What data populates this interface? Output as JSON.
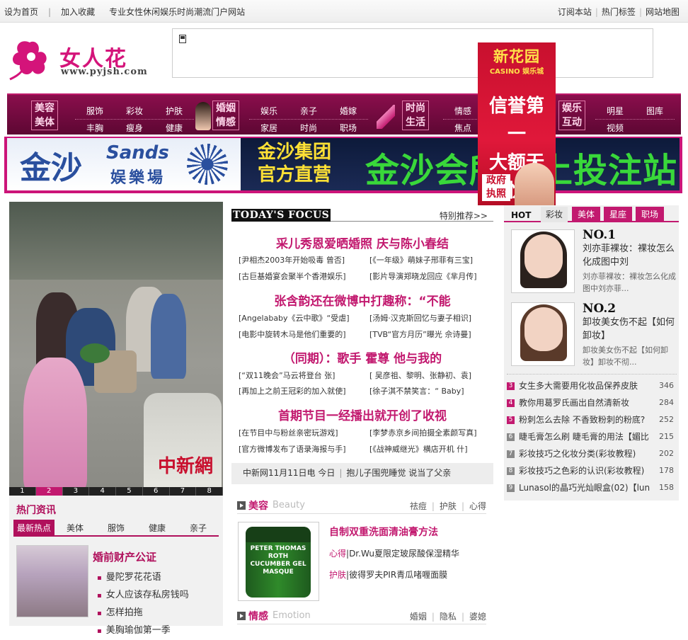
{
  "topbar": {
    "left": [
      "设为首页",
      "加入收藏",
      "专业女性休闲娱乐时尚潮流门户网站"
    ],
    "sep": "|",
    "right": [
      "订阅本站",
      "热门标签",
      "网站地图"
    ]
  },
  "logo": {
    "name": "女人花",
    "url": "www.pyjsh.com"
  },
  "nav": [
    {
      "head": [
        "美容",
        "美体"
      ],
      "items": [
        [
          "服饰",
          "彩妆",
          "护肤"
        ],
        [
          "丰胸",
          "瘦身",
          "健康"
        ]
      ]
    },
    {
      "head": [
        "婚姻",
        "情感"
      ],
      "items": [
        [
          "娱乐",
          "亲子",
          "婚嫁"
        ],
        [
          "家居",
          "时尚",
          "职场"
        ]
      ]
    },
    {
      "head": [
        "时尚",
        "生活"
      ],
      "items": [
        [
          "情感"
        ],
        [
          "焦点"
        ]
      ]
    },
    {
      "head": [
        "娱乐",
        "互动"
      ],
      "items": [
        [
          "明星",
          "图库"
        ],
        [
          "视频"
        ]
      ]
    }
  ],
  "tall_ad": {
    "line1": "新花园",
    "line2": "CASINO 娱乐城",
    "line3": "信誉第一",
    "line4": "大额无忧",
    "badge": "政府执照"
  },
  "banner": {
    "left_cn": "金沙",
    "left_en": "Sands",
    "left_sub": "娱樂場",
    "right_a": "金沙集团",
    "right_b": "官方直营",
    "right_c": "金沙会所会上投注站"
  },
  "slideshow": {
    "dots": [
      "1",
      "2",
      "3",
      "4",
      "5",
      "6",
      "7",
      "8"
    ],
    "active": 1,
    "stamp": "中新網"
  },
  "hot_news": {
    "heading": "热门资讯",
    "tabs": [
      "最新热点",
      "美体",
      "服饰",
      "健康",
      "亲子"
    ],
    "active_tab": 0,
    "title": "婚前财产公证",
    "items": [
      "曼陀罗花花语",
      "女人应该存私房钱吗",
      "怎样拍拖",
      "美胸瑜伽第一季"
    ]
  },
  "focus": {
    "heading": "TODAY'S FOCUS",
    "more": "特别推荐>>",
    "blocks": [
      {
        "title": "采儿秀恩爱晒婚照 庆与陈小春结",
        "rows": [
          [
            "[尹相杰2003年开始吸毒 曾否]",
            "[《一年级》萌妹子邢菲有三宝]"
          ],
          [
            "[古巨基婚宴会聚半个香港娱乐]",
            "[影片导演郑晓龙回应《芈月传]"
          ]
        ]
      },
      {
        "title": "张含韵还在微博中打趣称：“不能",
        "rows": [
          [
            "[Angelababy《云中歌》“受虐]",
            "[汤姆·汉克斯回忆与妻子相识]"
          ],
          [
            "[电影中旋转木马是他们重要的]",
            "[TVB“官方月历”曝光 佘诗曼]"
          ]
        ]
      },
      {
        "title": "（同期）：歌手 霍尊 他与我的",
        "rows": [
          [
            "[“双11晚会”马云将登台 张]",
            "[ 吴彦祖、黎明、张静初、袁]"
          ],
          [
            "[再加上之前王冠彩的加入就使]",
            "[徐子淇不禁笑言：“ Baby]"
          ]
        ]
      },
      {
        "title": "首期节目一经播出就开创了收视",
        "rows": [
          [
            "[在节目中与粉丝亲密玩游戏]",
            "[李梦赤京乡间拍摄全素颜写真]"
          ],
          [
            "[官方微博发布了语录海报与手]",
            "[《战神威继光》横店开机 什]"
          ]
        ]
      }
    ],
    "news": [
      "中新网11月11日电 今日",
      "抱儿子围兜睡觉 说当了父亲"
    ]
  },
  "beauty": {
    "cn": "美容",
    "en": "Beauty",
    "links": [
      "祛痘",
      "护肤",
      "心得"
    ],
    "jar": "PETER THOMAS ROTH CUCUMBER GEL MASQUE",
    "headline": "自制双重洗面清油膏方法",
    "lines": [
      {
        "tag": "心得",
        "text": "Dr.Wu夏限定玻尿酸保湿精华"
      },
      {
        "tag": "护肤",
        "text": "彼得罗夫PIR青瓜啫喱面膜"
      }
    ]
  },
  "emotion": {
    "cn": "情感",
    "en": "Emotion",
    "links": [
      "婚姻",
      "隐私",
      "婆媳"
    ]
  },
  "right": {
    "hot": "HOT",
    "tabs": [
      "彩妆",
      "美体",
      "星座",
      "职场"
    ],
    "active_tab": 0,
    "top": [
      {
        "no": "NO.1",
        "title": "刘亦菲裸妆：裸妆怎么化成图中刘",
        "desc": "刘亦菲裸妆：裸妆怎么化成图中刘亦菲..."
      },
      {
        "no": "NO.2",
        "title": "卸妆美女伤不起【如何卸妆】",
        "desc": "卸妆美女伤不起【如何卸妆】卸妆不彻..."
      }
    ],
    "list": [
      {
        "n": "3",
        "t": "女生多大需要用化妆品保养皮肤",
        "c": "346"
      },
      {
        "n": "4",
        "t": "教你用葛罗氏画出自然清新妆",
        "c": "284"
      },
      {
        "n": "5",
        "t": "粉刺怎么去除 不香致粉刺的粉底?",
        "c": "252"
      },
      {
        "n": "6",
        "t": "睫毛膏怎么刷 睫毛膏的用法【媚比",
        "c": "215"
      },
      {
        "n": "7",
        "t": "彩妆技巧之化妆分类(彩妆教程)",
        "c": "202"
      },
      {
        "n": "8",
        "t": "彩妆技巧之色彩的认识(彩妆教程)",
        "c": "178"
      },
      {
        "n": "9",
        "t": "Lunasol的晶巧光灿眼盒(02)【lun",
        "c": "158"
      }
    ]
  },
  "colors": {
    "brand": "#c2196f",
    "nav_bg": "#6e0a3e"
  }
}
